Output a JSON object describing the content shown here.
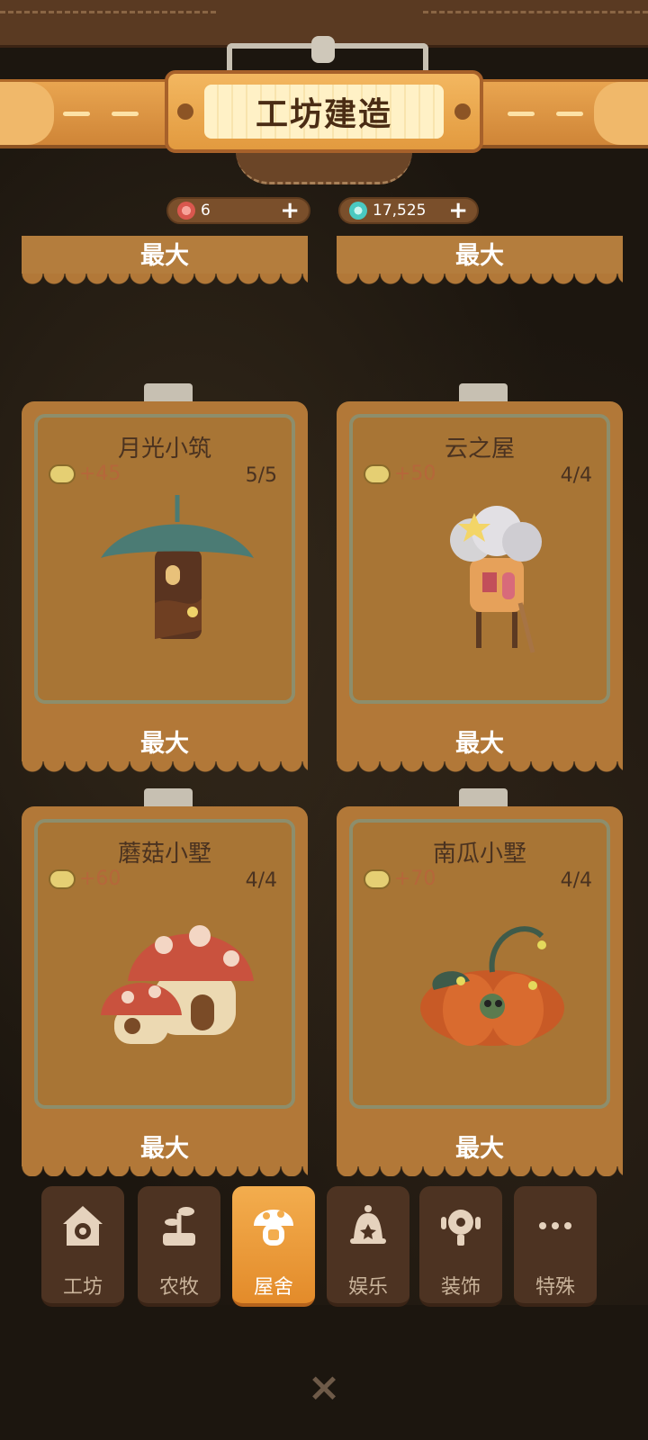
{
  "header": {
    "title": "工坊建造"
  },
  "currency": [
    {
      "icon": "flower-token-icon",
      "value": "6",
      "plus": "+"
    },
    {
      "icon": "star-gem-icon",
      "value": "17,525",
      "plus": "+"
    }
  ],
  "cards": [
    {
      "name": "",
      "income": "",
      "level": "",
      "status": "最大",
      "art": ""
    },
    {
      "name": "",
      "income": "",
      "level": "",
      "status": "最大",
      "art": ""
    },
    {
      "name": "月光小筑",
      "income": "+45",
      "level": "5/5",
      "status": "最大",
      "art": "leaf-roof-tree-house"
    },
    {
      "name": "云之屋",
      "income": "+50",
      "level": "4/4",
      "status": "最大",
      "art": "cloud-house"
    },
    {
      "name": "蘑菇小墅",
      "income": "+60",
      "level": "4/4",
      "status": "最大",
      "art": "mushroom-house"
    },
    {
      "name": "南瓜小墅",
      "income": "+70",
      "level": "4/4",
      "status": "最大",
      "art": "pumpkin-house"
    }
  ],
  "tabs": [
    {
      "label": "工坊",
      "icon": "workshop-gear-icon",
      "active": false
    },
    {
      "label": "农牧",
      "icon": "sprout-icon",
      "active": false
    },
    {
      "label": "屋舍",
      "icon": "mushroom-house-icon",
      "active": true
    },
    {
      "label": "娱乐",
      "icon": "bell-icon",
      "active": false
    },
    {
      "label": "装饰",
      "icon": "flower-ornament-icon",
      "active": false
    },
    {
      "label": "特殊",
      "icon": "more-dots-icon",
      "active": false
    }
  ],
  "close": {
    "label": "×"
  },
  "colors": {
    "accent": "#e9a550",
    "card": "#b27838",
    "tab_active": "#f3ad4e",
    "tab_idle": "#4d3322"
  }
}
